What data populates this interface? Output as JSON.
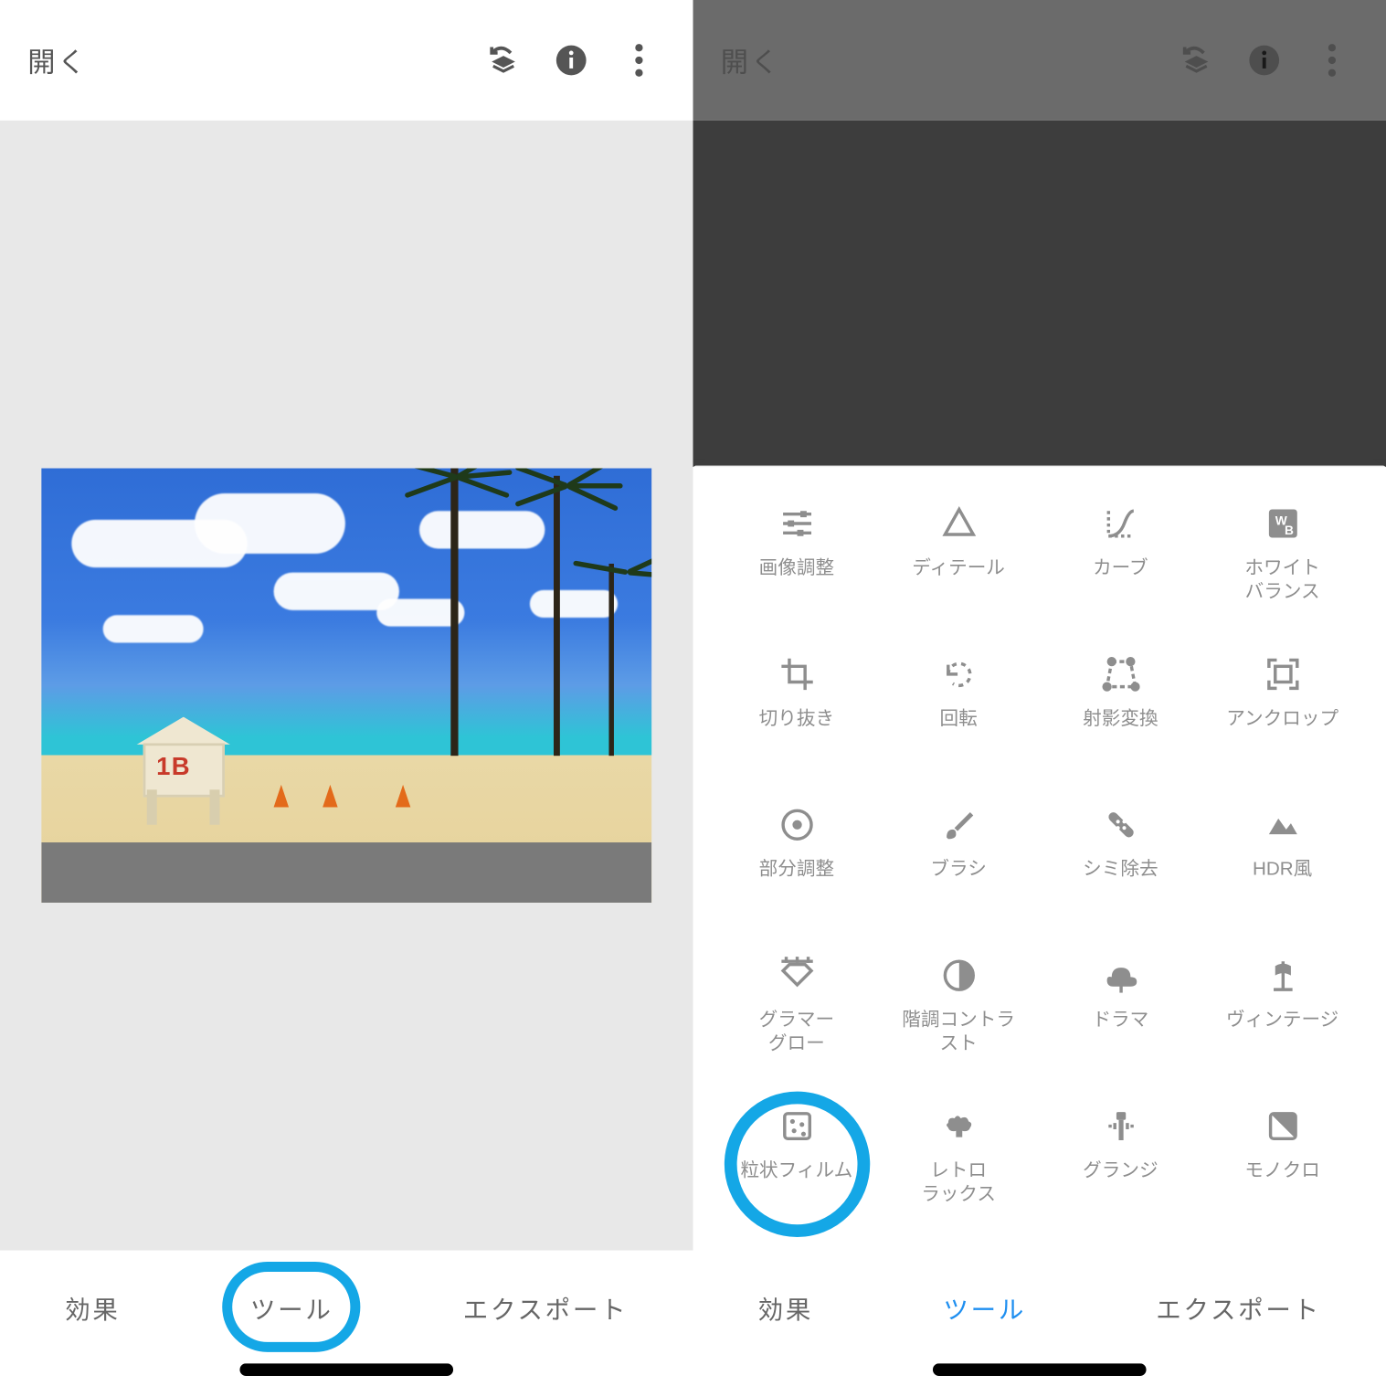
{
  "left": {
    "topbar": {
      "open": "開く"
    },
    "photo": {
      "hut_number": "1B"
    },
    "tabs": {
      "effects": "効果",
      "tools": "ツール",
      "export": "エクスポート"
    }
  },
  "right": {
    "topbar": {
      "open": "開く"
    },
    "tabs": {
      "effects": "効果",
      "tools": "ツール",
      "export": "エクスポート"
    },
    "tools": [
      {
        "id": "tune",
        "label": "画像調整"
      },
      {
        "id": "details",
        "label": "ディテール"
      },
      {
        "id": "curves",
        "label": "カーブ"
      },
      {
        "id": "wb",
        "label": "ホワイト\nバランス"
      },
      {
        "id": "crop",
        "label": "切り抜き"
      },
      {
        "id": "rotate",
        "label": "回転"
      },
      {
        "id": "perspective",
        "label": "射影変換"
      },
      {
        "id": "uncrop",
        "label": "アンクロップ"
      },
      {
        "id": "selective",
        "label": "部分調整"
      },
      {
        "id": "brush",
        "label": "ブラシ"
      },
      {
        "id": "healing",
        "label": "シミ除去"
      },
      {
        "id": "hdr",
        "label": "HDR風"
      },
      {
        "id": "glamour",
        "label": "グラマー\nグロー"
      },
      {
        "id": "tonal",
        "label": "階調コントラ\nスト"
      },
      {
        "id": "drama",
        "label": "ドラマ"
      },
      {
        "id": "vintage",
        "label": "ヴィンテージ"
      },
      {
        "id": "grainy",
        "label": "粒状フィルム"
      },
      {
        "id": "retrolux",
        "label": "レトロ\nラックス"
      },
      {
        "id": "grunge",
        "label": "グランジ"
      },
      {
        "id": "mono",
        "label": "モノクロ"
      }
    ]
  },
  "colors": {
    "accent": "#14a7e6",
    "tab_active": "#1f8ff0",
    "icon": "#8e8e8e"
  }
}
